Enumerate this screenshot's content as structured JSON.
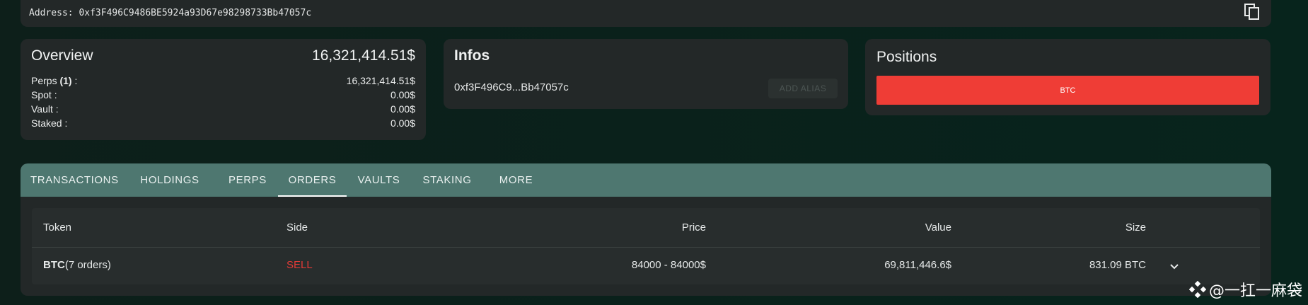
{
  "address": {
    "text": "Address: 0xf3F496C9486BE5924a93D67e98298733Bb47057c",
    "copy_icon": "copy-icon"
  },
  "overview": {
    "title": "Overview",
    "total": "16,321,414.51$",
    "rows": [
      {
        "label": "Perps",
        "count": "(1)",
        "suffix": " :",
        "value": "16,321,414.51$"
      },
      {
        "label": "Spot :",
        "value": "0.00$"
      },
      {
        "label": "Vault :",
        "value": "0.00$"
      },
      {
        "label": "Staked :",
        "value": "0.00$"
      }
    ]
  },
  "infos": {
    "title": "Infos",
    "address_short": "0xf3F496C9...Bb47057c",
    "alias_button": "ADD ALIAS"
  },
  "positions": {
    "title": "Positions",
    "bar_label": "BTC",
    "bar_color": "#ef3d36"
  },
  "tabs": [
    {
      "label": "TRANSACTIONS"
    },
    {
      "label": "HOLDINGS"
    },
    {
      "label": "PERPS"
    },
    {
      "label": "ORDERS",
      "active": true
    },
    {
      "label": "VAULTS"
    },
    {
      "label": "STAKING"
    },
    {
      "label": "MORE"
    }
  ],
  "orders_table": {
    "headers": {
      "token": "Token",
      "side": "Side",
      "price": "Price",
      "value": "Value",
      "size": "Size"
    },
    "rows": [
      {
        "token": "BTC",
        "orders": "(7 orders)",
        "side": "SELL",
        "price": "84000 - 84000$",
        "value": "69,811,446.6$",
        "size": "831.09 BTC",
        "expand_icon": "chevron-down-icon"
      }
    ]
  },
  "watermark": {
    "text": "@一扛一麻袋"
  },
  "colors": {
    "accent_tab": "#4e7770",
    "sell": "#e23a36",
    "card": "#232828"
  }
}
